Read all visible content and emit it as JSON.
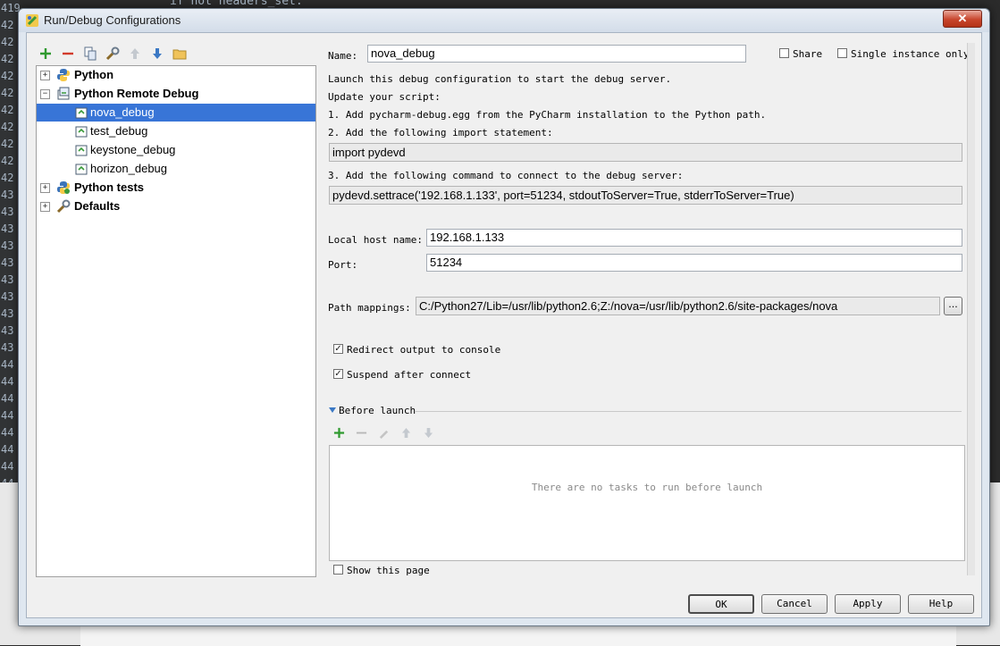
{
  "background": {
    "line_numbers": [
      "419",
      "42",
      "42",
      "42",
      "42",
      "42",
      "42",
      "42",
      "42",
      "42",
      "42",
      "43",
      "43",
      "43",
      "43",
      "43",
      "43",
      "43",
      "43",
      "43",
      "43",
      "44",
      "44",
      "44",
      "44",
      "44",
      "44",
      "44",
      "44"
    ],
    "code_snippet": "if not headers_set:"
  },
  "window": {
    "title": "Run/Debug Configurations",
    "close_label": "✕"
  },
  "toolbar": {
    "icons": [
      "add-icon",
      "remove-icon",
      "copy-icon",
      "edit-defaults-icon",
      "move-up-icon",
      "move-down-icon",
      "folder-icon"
    ]
  },
  "tree": {
    "items": [
      {
        "label": "Python",
        "type": "group",
        "expanded": false
      },
      {
        "label": "Python Remote Debug",
        "type": "group",
        "expanded": true
      },
      {
        "label": "nova_debug",
        "type": "config",
        "selected": true
      },
      {
        "label": "test_debug",
        "type": "config"
      },
      {
        "label": "keystone_debug",
        "type": "config"
      },
      {
        "label": "horizon_debug",
        "type": "config"
      },
      {
        "label": "Python tests",
        "type": "group",
        "expanded": false
      },
      {
        "label": "Defaults",
        "type": "group",
        "expanded": false
      }
    ]
  },
  "form": {
    "name_label": "Name:",
    "name_value": "nova_debug",
    "share_label": "Share",
    "share_checked": false,
    "single_instance_label": "Single instance only",
    "single_instance_checked": false,
    "instructions": {
      "line1": "Launch this debug configuration to start the debug server.",
      "line2": "Update your script:",
      "step1": "1. Add pycharm-debug.egg from the PyCharm installation to the Python path.",
      "step2": "2. Add the following import statement:",
      "import_code": "import pydevd",
      "step3": "3. Add the following command to connect to the debug server:",
      "settrace_code": "pydevd.settrace('192.168.1.133', port=51234, stdoutToServer=True, stderrToServer=True)"
    },
    "host_label": "Local host name:",
    "host_value": "192.168.1.133",
    "port_label": "Port:",
    "port_value": "51234",
    "path_label": "Path mappings:",
    "path_value": "C:/Python27/Lib=/usr/lib/python2.6;Z:/nova=/usr/lib/python2.6/site-packages/nova",
    "path_browse_label": "...",
    "redirect_label": "Redirect output to console",
    "redirect_checked": true,
    "suspend_label": "Suspend after connect",
    "suspend_checked": true,
    "before_launch_label": "Before launch",
    "before_launch_toolbar_icons": [
      "add-icon",
      "remove-icon",
      "edit-icon",
      "move-up-icon",
      "move-down-icon"
    ],
    "no_tasks_text": "There are no tasks to run before launch",
    "show_page_label": "Show this page",
    "show_page_checked": false
  },
  "buttons": {
    "ok": "OK",
    "cancel": "Cancel",
    "apply": "Apply",
    "help": "Help"
  }
}
